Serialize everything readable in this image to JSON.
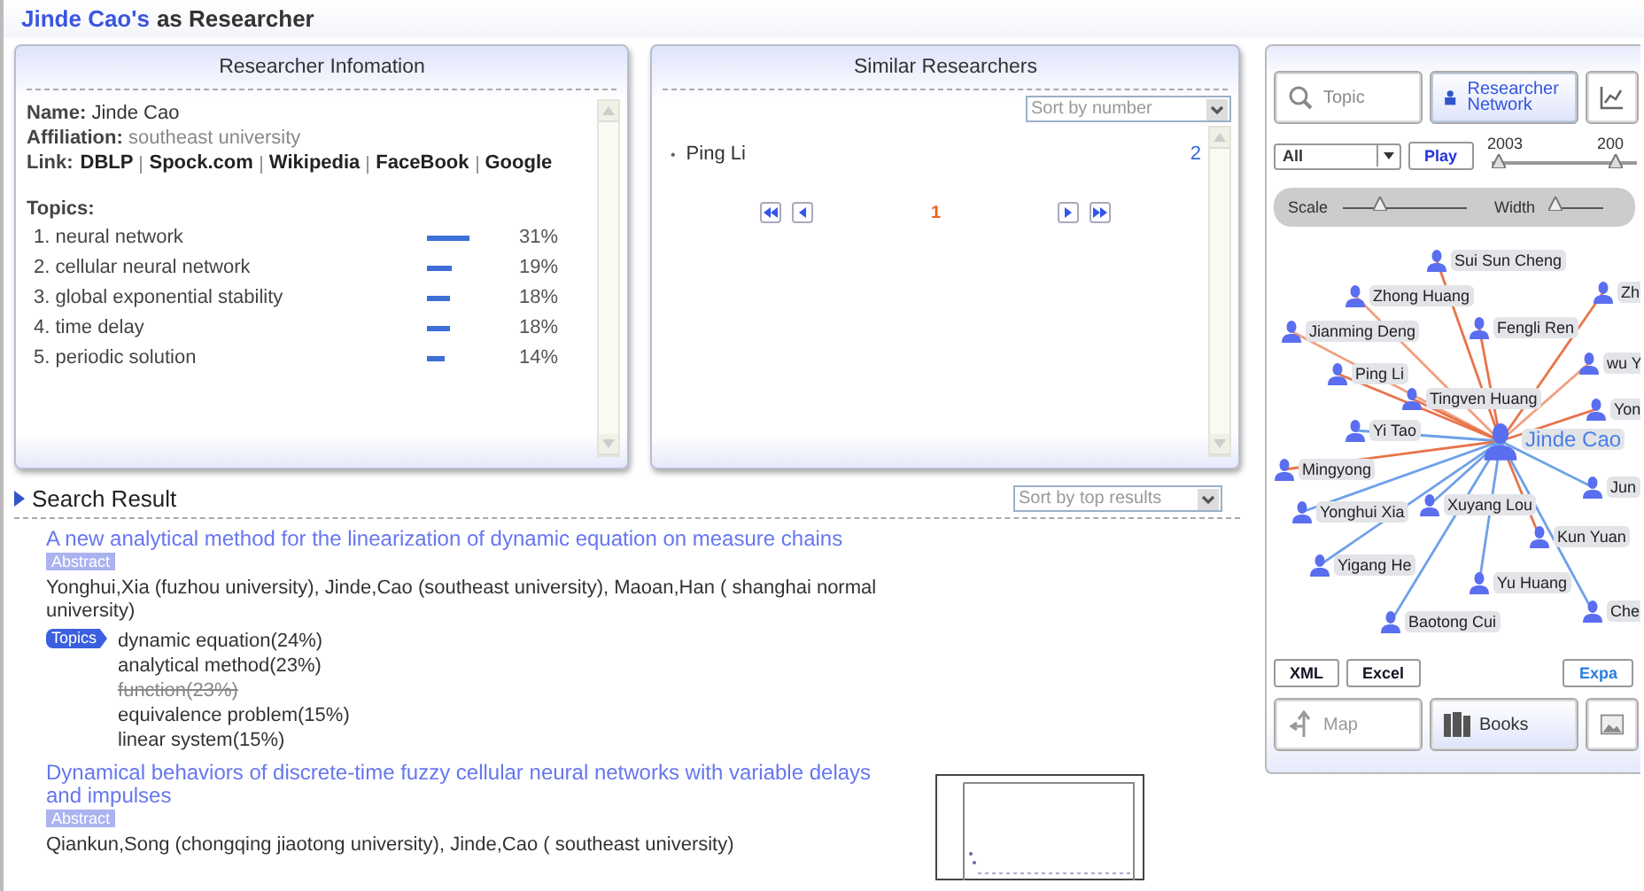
{
  "header": {
    "name": "Jinde Cao's",
    "suffix": "as Researcher"
  },
  "info_panel": {
    "title": "Researcher Infomation",
    "name_label": "Name:",
    "name": "Jinde Cao",
    "affiliation_label": "Affiliation:",
    "affiliation": "southeast university",
    "link_label": "Link:",
    "links": [
      "DBLP",
      "Spock.com",
      "Wikipedia",
      "FaceBook",
      "Google"
    ],
    "topics_label": "Topics:",
    "topics": [
      {
        "label": "1. neural network",
        "percent": "31%"
      },
      {
        "label": "2. cellular neural network",
        "percent": "19%"
      },
      {
        "label": "3. global exponential stability",
        "percent": "18%"
      },
      {
        "label": "4. time delay",
        "percent": "18%"
      },
      {
        "label": "5. periodic solution",
        "percent": "14%"
      }
    ]
  },
  "similar_panel": {
    "title": "Similar Researchers",
    "sort": "Sort by number",
    "researchers": [
      {
        "bullet": "•",
        "name": "Ping Li",
        "count": "2"
      }
    ],
    "page": "1"
  },
  "search": {
    "title": "Search Result",
    "sort": "Sort by top results",
    "results": [
      {
        "title": "A new analytical method for the linearization of dynamic equation on measure chains",
        "badge": "Abstract",
        "authors": "Yonghui,Xia (fuzhou university), Jinde,Cao (southeast university), Maoan,Han ( shanghai normal university)",
        "topics_badge": "Topics",
        "topics": [
          {
            "label": "dynamic equation(24%)",
            "struck": false
          },
          {
            "label": "analytical method(23%)",
            "struck": false
          },
          {
            "label": "function(23%)",
            "struck": true
          },
          {
            "label": "equivalence problem(15%)",
            "struck": false
          },
          {
            "label": "linear system(15%)",
            "struck": false
          }
        ]
      },
      {
        "title": "Dynamical behaviors of discrete-time fuzzy cellular neural networks with variable delays and impulses",
        "badge": "Abstract",
        "authors": "Qiankun,Song (chongqing jiaotong university), Jinde,Cao ( southeast university)",
        "thumbnail": true
      }
    ]
  },
  "network_panel": {
    "modes": [
      {
        "kind": "search",
        "label": "Topic",
        "selected": false
      },
      {
        "kind": "person",
        "label": "Researcher Network",
        "selected": true
      },
      {
        "kind": "chart",
        "selected": false
      }
    ],
    "filter": "All",
    "play": "Play",
    "year_start": "2003",
    "year_end": "200",
    "scale_label": "Scale",
    "scale": {
      "level": 0.3
    },
    "width_label": "Width",
    "width": {
      "level": 0.1
    },
    "nodes": [
      {
        "name": "Sui Sun Cheng",
        "color": "#e8744a"
      },
      {
        "name": "Zhong Huang",
        "color": "#f0a080"
      },
      {
        "name": "Jianming Deng",
        "color": "#f0a080"
      },
      {
        "name": "Fengli Ren",
        "color": "#e8744a"
      },
      {
        "name": "Zh",
        "color": "#e8744a"
      },
      {
        "name": "wu Y",
        "color": "#f0a080"
      },
      {
        "name": "Ping Li",
        "color": "#e8744a"
      },
      {
        "name": "Tingven Huang",
        "color": "#e8744a"
      },
      {
        "name": "Yon",
        "color": "#e8744a"
      },
      {
        "name": "Yi Tao",
        "color": "#6fa0e8"
      },
      {
        "name": "Mingyong",
        "color": "#e8744a"
      },
      {
        "name": "Yonghui Xia",
        "color": "#6fa0e8"
      },
      {
        "name": "Jun",
        "color": "#6fa0e8"
      },
      {
        "name": "Xuyang Lou",
        "color": "#6fa0e8"
      },
      {
        "name": "Kun Yuan",
        "color": "#e8744a"
      },
      {
        "name": "Yigang He",
        "color": "#6fa0e8"
      },
      {
        "name": "Yu Huang",
        "color": "#6fa0e8"
      },
      {
        "name": "Baotong Cui",
        "color": "#6fa0e8"
      },
      {
        "name": "Che",
        "color": "#6fa0e8"
      }
    ],
    "center": "Jinde Cao",
    "exports": [
      "XML",
      "Excel"
    ],
    "expand": "Expa",
    "views": [
      {
        "kind": "map",
        "label": "Map",
        "selected": false
      },
      {
        "kind": "books",
        "label": "Books",
        "selected": true
      },
      {
        "kind": "image",
        "selected": false
      }
    ]
  }
}
